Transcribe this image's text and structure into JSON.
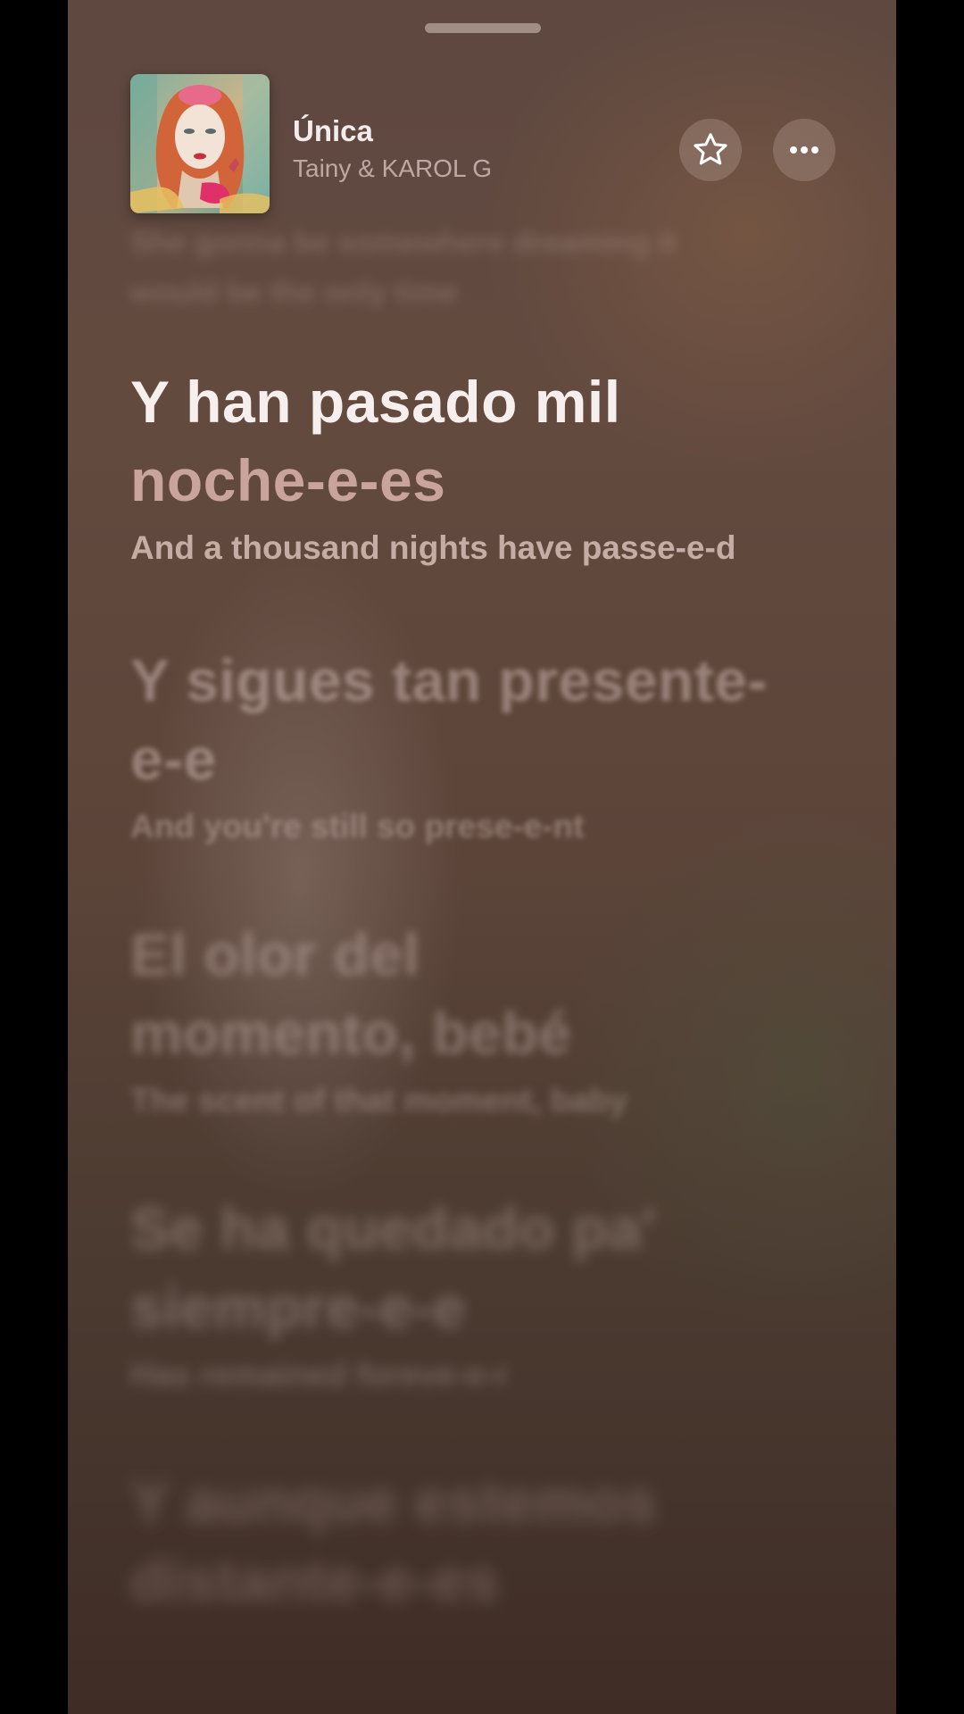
{
  "header": {
    "title": "Única",
    "artist": "Tainy & KAROL G",
    "album_art_icon": "album-art-illustration",
    "favorite_icon": "star-outline-icon",
    "more_icon": "ellipsis-icon"
  },
  "lyrics": {
    "previous": [
      "She gonna be somewhere dreaming it",
      "would be the only time"
    ],
    "current": {
      "line1": "Y han pasado mil",
      "line2": "noche-e-es",
      "translation": "And a thousand nights have passe-e-d"
    },
    "upcoming": [
      {
        "line1": "Y sigues tan presente-",
        "line2": "e-e",
        "translation": "And you're still so prese-e-nt"
      },
      {
        "line1": "El olor del",
        "line2": "momento, bebé",
        "translation": "The scent of that moment, baby"
      },
      {
        "line1": "Se ha quedado pa'",
        "line2": "siempre-e-e",
        "translation": "Has remained foreve-e-r"
      },
      {
        "line1": "Y aunque estemos",
        "line2": "distante-e-es",
        "translation": ""
      }
    ]
  },
  "colors": {
    "background_top": "#5e4840",
    "background_bottom": "#3f2d25",
    "active_text": "#f7efee",
    "active_dim_text": "#e6beb9"
  }
}
